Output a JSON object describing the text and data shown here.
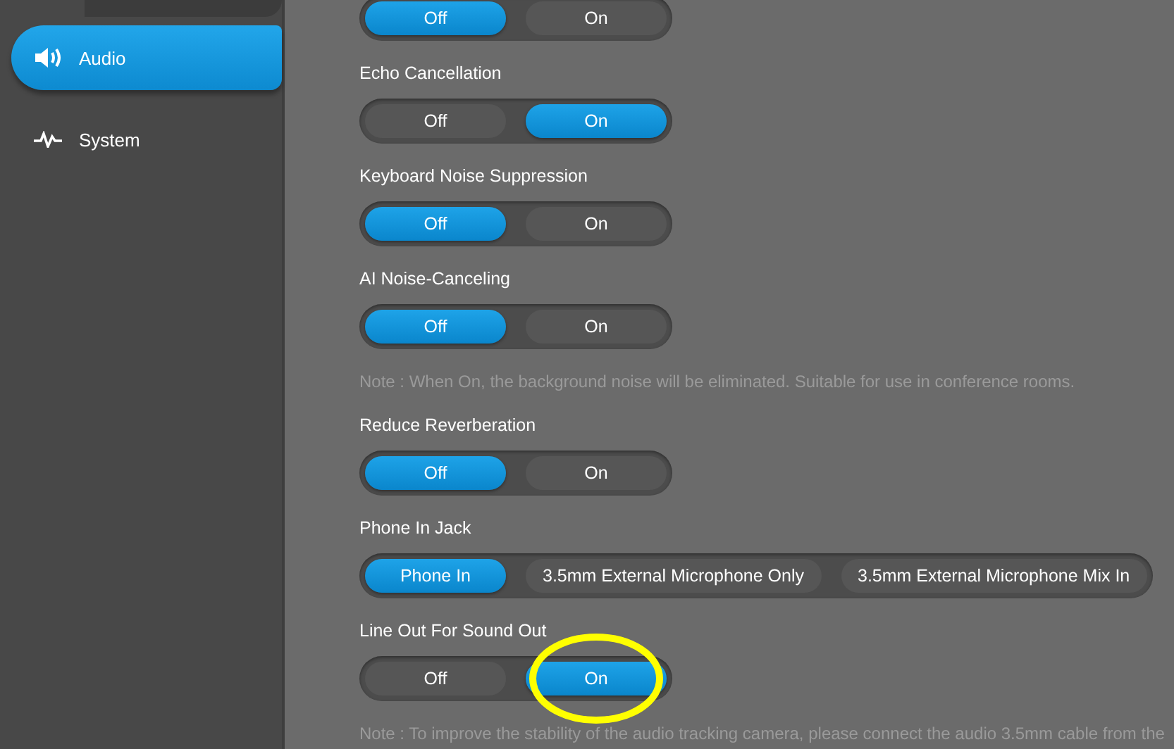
{
  "sidebar": {
    "items": [
      {
        "label": "Audio",
        "kind": "audio",
        "selected": true
      },
      {
        "label": "System",
        "kind": "system",
        "selected": false
      }
    ]
  },
  "settings": [
    {
      "kind": "toggle",
      "options": [
        {
          "label": "Off",
          "selected": true
        },
        {
          "label": "On",
          "selected": false
        }
      ]
    },
    {
      "kind": "toggle",
      "label": "Echo Cancellation",
      "options": [
        {
          "label": "Off",
          "selected": false
        },
        {
          "label": "On",
          "selected": true
        }
      ]
    },
    {
      "kind": "toggle",
      "label": "Keyboard Noise Suppression",
      "options": [
        {
          "label": "Off",
          "selected": true
        },
        {
          "label": "On",
          "selected": false
        }
      ]
    },
    {
      "kind": "toggle",
      "label": "AI Noise-Canceling",
      "options": [
        {
          "label": "Off",
          "selected": true
        },
        {
          "label": "On",
          "selected": false
        }
      ]
    },
    {
      "kind": "note",
      "text": "Note : When On, the background noise will be eliminated. Suitable for use in conference rooms."
    },
    {
      "kind": "toggle",
      "label": "Reduce Reverberation",
      "options": [
        {
          "label": "Off",
          "selected": true
        },
        {
          "label": "On",
          "selected": false
        }
      ]
    },
    {
      "kind": "toggle",
      "label": "Phone In Jack",
      "options": [
        {
          "label": "Phone In",
          "selected": true
        },
        {
          "label": "3.5mm External Microphone Only",
          "selected": false
        },
        {
          "label": "3.5mm External Microphone Mix In",
          "selected": false
        }
      ]
    },
    {
      "kind": "toggle",
      "label": "Line Out For Sound Out",
      "options": [
        {
          "label": "Off",
          "selected": false
        },
        {
          "label": "On",
          "selected": true,
          "highlighted": true
        }
      ]
    },
    {
      "kind": "note",
      "text": "Note : To improve the stability of the audio tracking camera, please connect the audio 3.5mm cable from the"
    }
  ]
}
